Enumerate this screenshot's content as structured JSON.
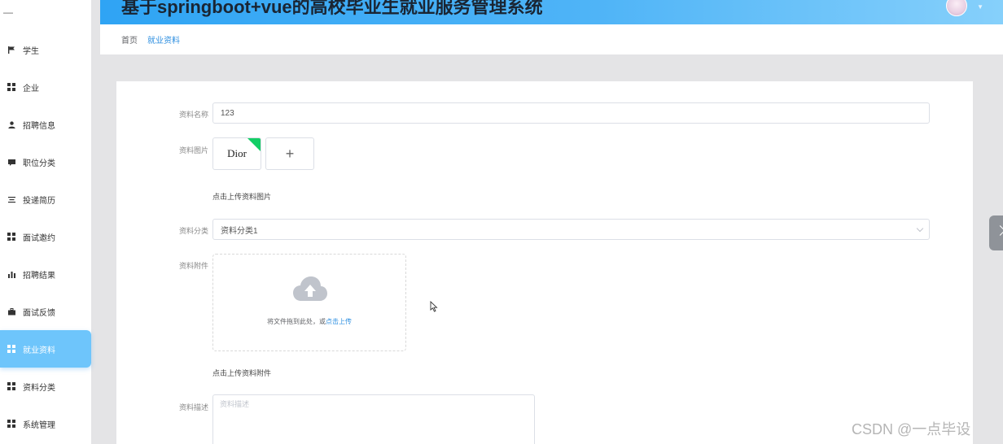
{
  "app": {
    "title": "基于springboot+vue的高校毕业生就业服务管理系统",
    "collapse_label": "—"
  },
  "sidebar": {
    "items": [
      {
        "label": "学生",
        "icon": "flag-icon"
      },
      {
        "label": "企业",
        "icon": "grid-icon"
      },
      {
        "label": "招聘信息",
        "icon": "user-icon"
      },
      {
        "label": "职位分类",
        "icon": "message-icon"
      },
      {
        "label": "投递简历",
        "icon": "list-icon"
      },
      {
        "label": "面试邀约",
        "icon": "grid-icon"
      },
      {
        "label": "招聘结果",
        "icon": "bar-chart-icon"
      },
      {
        "label": "面试反馈",
        "icon": "briefcase-icon"
      },
      {
        "label": "就业资料",
        "icon": "grid-icon",
        "active": true
      },
      {
        "label": "资料分类",
        "icon": "grid-icon"
      },
      {
        "label": "系统管理",
        "icon": "grid-icon"
      }
    ]
  },
  "breadcrumb": {
    "home": "首页",
    "current": "就业资料"
  },
  "form": {
    "name_label": "资料名称",
    "name_value": "123",
    "image_label": "资料图片",
    "image_thumb_text": "Dior",
    "image_add": "+",
    "image_hint": "点击上传资料图片",
    "category_label": "资料分类",
    "category_value": "资料分类1",
    "attachment_label": "资料附件",
    "attachment_drop_text": "将文件拖到此处，或",
    "attachment_click_text": "点击上传",
    "attachment_hint": "点击上传资料附件",
    "desc_label": "资料描述",
    "desc_placeholder": "资料描述"
  },
  "watermark": "CSDN @一点毕设",
  "colors": {
    "accent": "#2e8fe0",
    "active_menu": "#6ec5fb",
    "header_start": "#2fa4f4",
    "header_end": "#86d0fb"
  }
}
